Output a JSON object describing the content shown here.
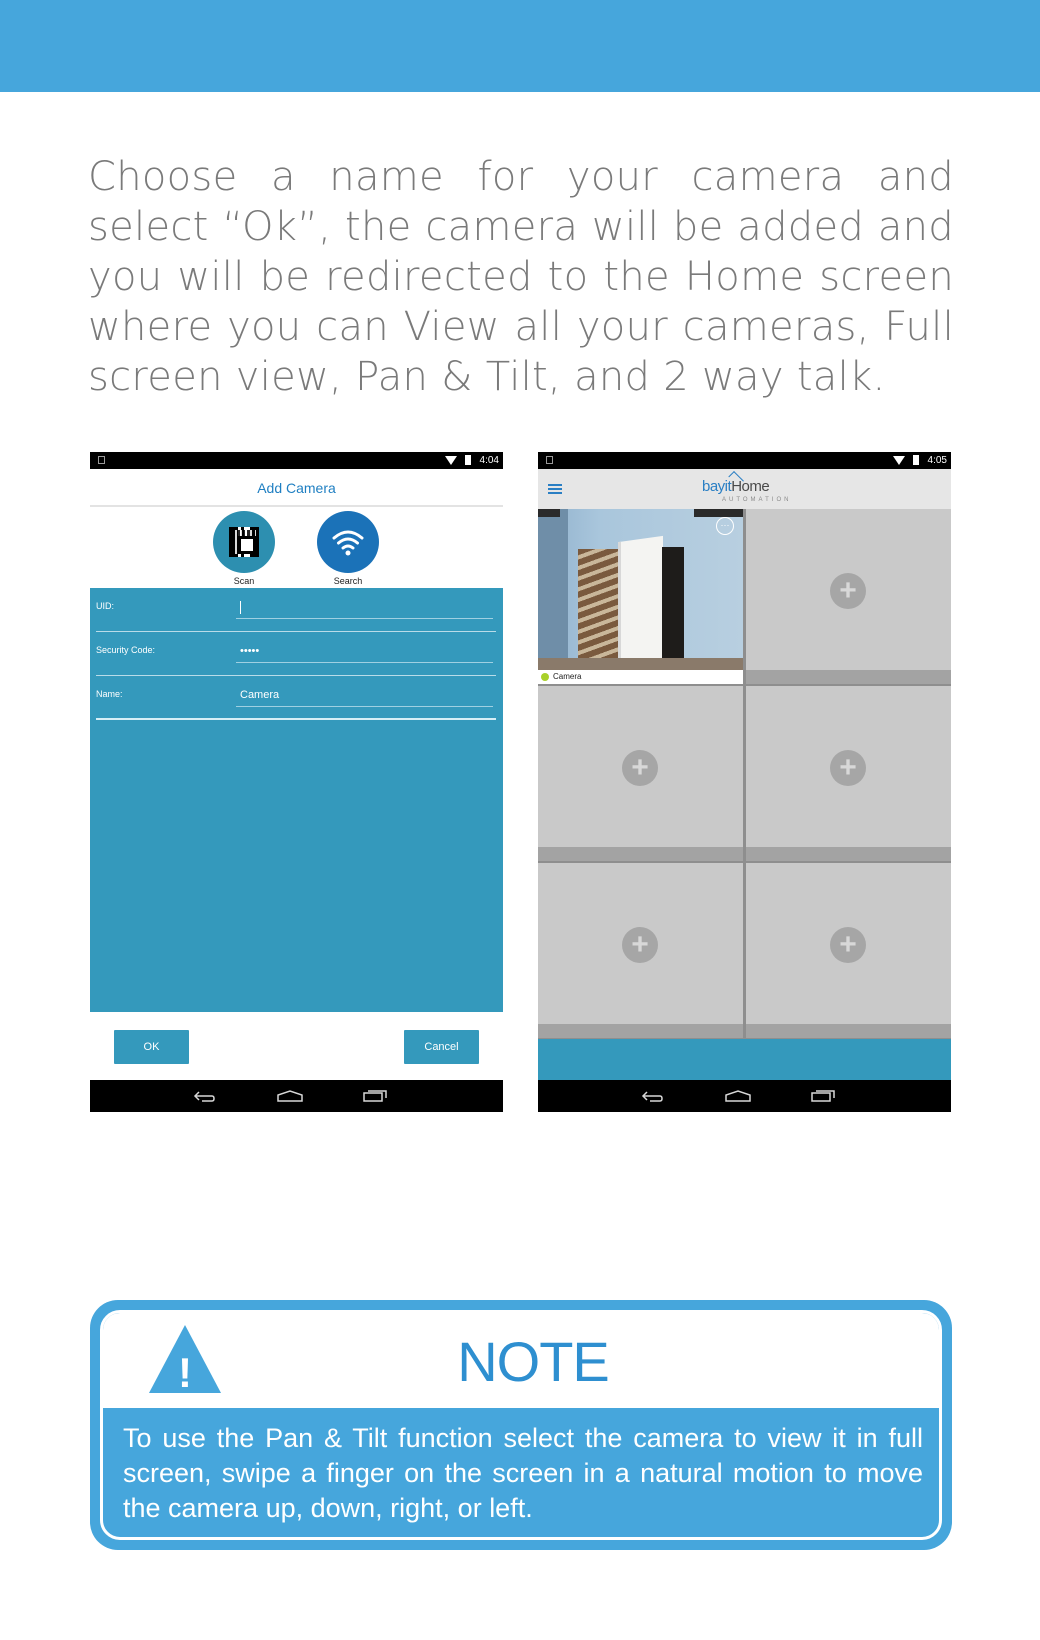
{
  "intro_text": "Choose a name for your camera and select “Ok”, the camera will be added and you will be redirected to the Home screen where you can View all your cameras, Full screen view, Pan & Tilt, and 2 way talk.",
  "add_camera_screen": {
    "clock": "4:04",
    "title": "Add Camera",
    "scan_label": "Scan",
    "search_label": "Search",
    "uid_label": "UID:",
    "uid_value": "",
    "security_code_label": "Security Code:",
    "security_code_value": "•••••",
    "name_label": "Name:",
    "name_value": "Camera",
    "ok_label": "OK",
    "cancel_label": "Cancel"
  },
  "home_screen": {
    "clock": "4:05",
    "brand_first": "bayit",
    "brand_second": "Home",
    "brand_sub": "AUTOMATION",
    "camera_caption": "Camera",
    "camera_menu_glyph": "···",
    "add_glyph": "+"
  },
  "note": {
    "title": "NOTE",
    "warning_glyph": "!",
    "text": "To use the Pan & Tilt function select the camera to view it in full screen, swipe a finger on the screen in a natural motion to move the camera up, down, right, or left."
  },
  "colors": {
    "brand_blue": "#46a6dc",
    "panel_teal": "#3499bc",
    "title_blue": "#2e8fd0"
  }
}
